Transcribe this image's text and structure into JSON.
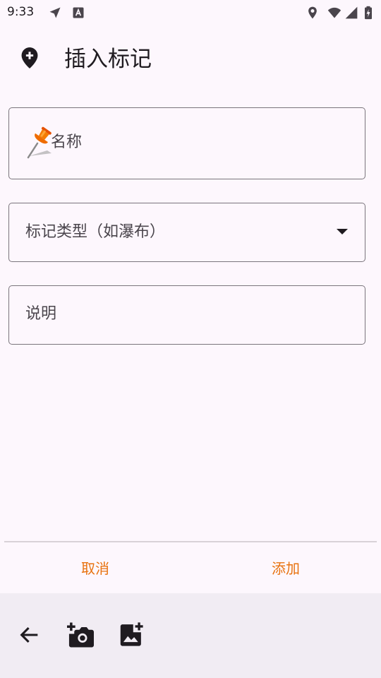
{
  "status_bar": {
    "time": "9:33"
  },
  "dialog": {
    "title": "插入标记",
    "title_icon": "add-location-icon"
  },
  "fields": {
    "name": {
      "placeholder": "名称",
      "icon": "pushpin-icon"
    },
    "marker_type": {
      "placeholder": "标记类型（如瀑布）",
      "icon": "dropdown-arrow-icon"
    },
    "description": {
      "placeholder": "说明"
    }
  },
  "actions": {
    "cancel_label": "取消",
    "add_label": "添加"
  },
  "toolbar": {
    "icons": [
      "back-arrow-icon",
      "add-camera-icon",
      "add-photo-icon"
    ]
  },
  "colors": {
    "background": "#fdf7fd",
    "accent": "#e8720f",
    "border": "#7a757c",
    "toolbar_bg": "#f1ecf3"
  }
}
